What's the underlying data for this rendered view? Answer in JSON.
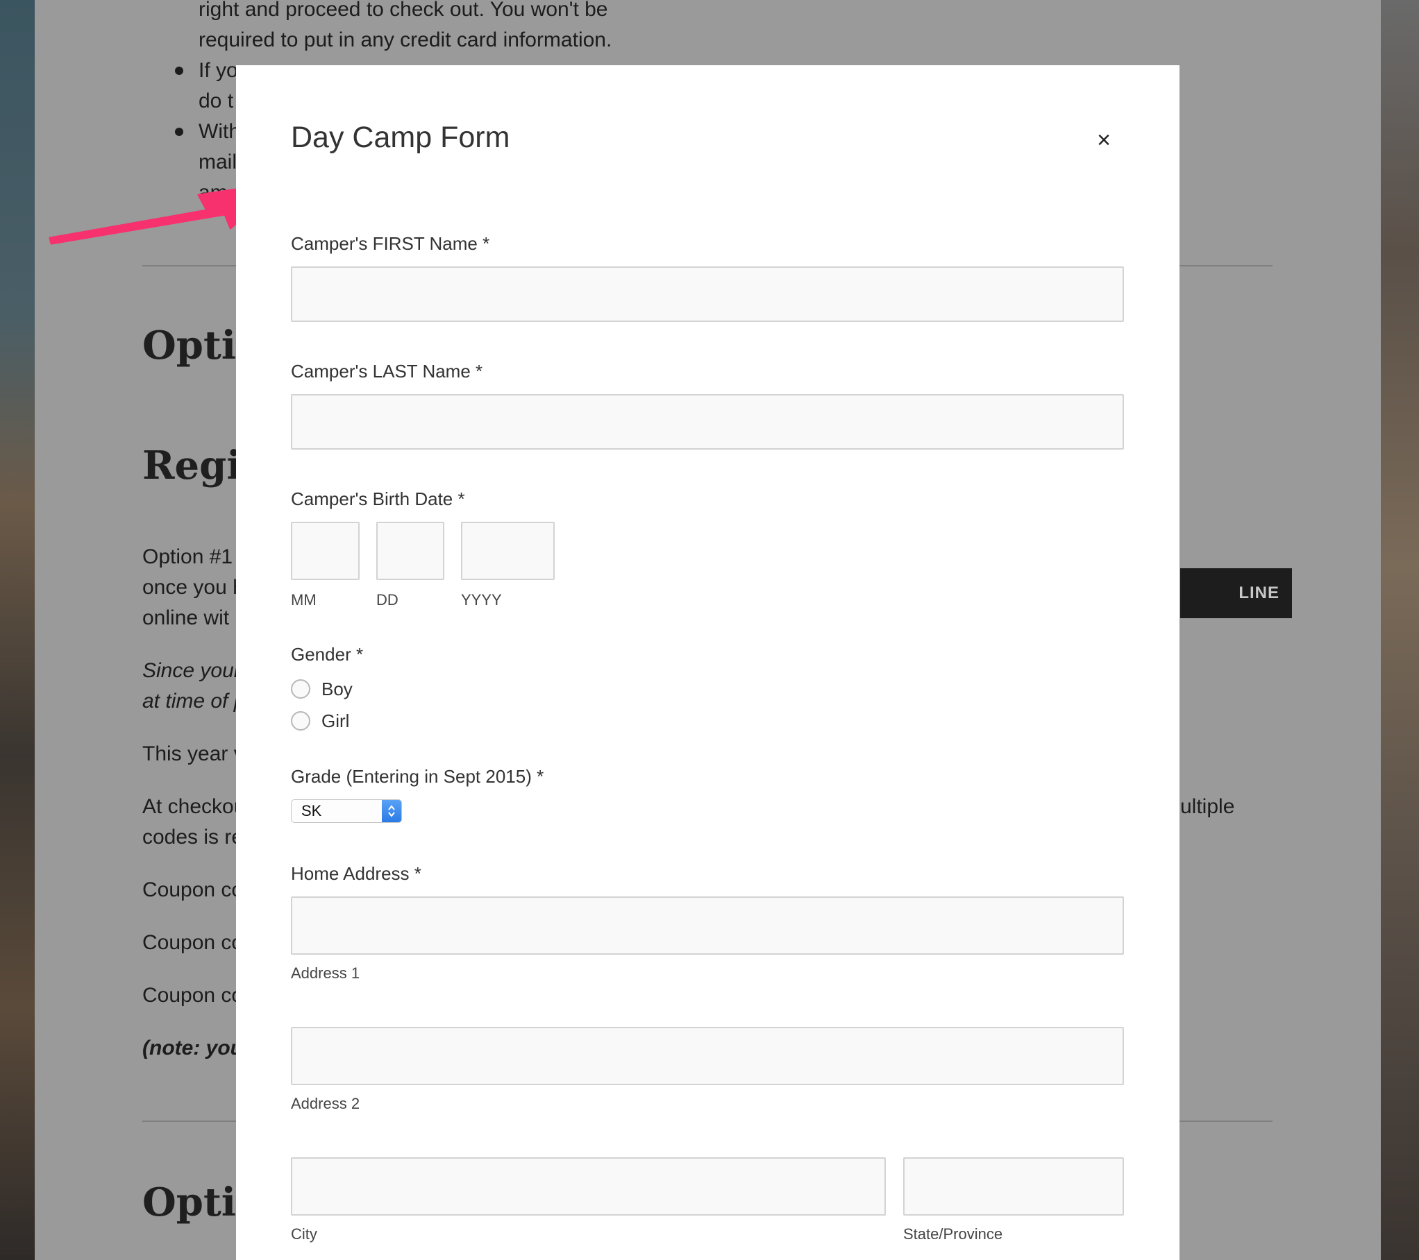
{
  "background_page": {
    "bullets": [
      {
        "lines": [
          "right and proceed to check out. You won't be",
          "required to put in any credit card information."
        ]
      },
      {
        "lines": [
          "If yo",
          "do t"
        ]
      },
      {
        "lines": [
          "With",
          "mail",
          "am"
        ]
      }
    ],
    "headings": [
      "Optio",
      "Regis",
      "Optio"
    ],
    "paragraph_option1": [
      "Option #1",
      "once you h",
      "online wit"
    ],
    "italic_lines": [
      "Since your",
      "at time of p"
    ],
    "this_year": "This year v",
    "checkout_lines": [
      "At checkou",
      "codes is re"
    ],
    "checkout_right": "ultiple",
    "coupon_lines": [
      "Coupon co",
      "Coupon co",
      "Coupon co"
    ],
    "note": "(note: you",
    "register_button_label": "LINE"
  },
  "modal": {
    "title": "Day Camp Form",
    "close_label": "×",
    "first_name": {
      "label": "Camper's FIRST Name *",
      "value": ""
    },
    "last_name": {
      "label": "Camper's LAST Name *",
      "value": ""
    },
    "birth_date": {
      "label": "Camper's Birth Date *",
      "mm_label": "MM",
      "dd_label": "DD",
      "yyyy_label": "YYYY",
      "mm": "",
      "dd": "",
      "yyyy": ""
    },
    "gender": {
      "label": "Gender *",
      "options": [
        "Boy",
        "Girl"
      ],
      "selected": null
    },
    "grade": {
      "label": "Grade (Entering in Sept 2015) *",
      "selected": "SK"
    },
    "address": {
      "label": "Home Address *",
      "address1_label": "Address 1",
      "address2_label": "Address 2",
      "city_label": "City",
      "state_label": "State/Province",
      "address1": "",
      "address2": "",
      "city": "",
      "state": ""
    }
  },
  "colors": {
    "arrow": "#f7306e",
    "overlay_gray": "#9a9a9a",
    "select_accent": "#2a7ae6"
  }
}
